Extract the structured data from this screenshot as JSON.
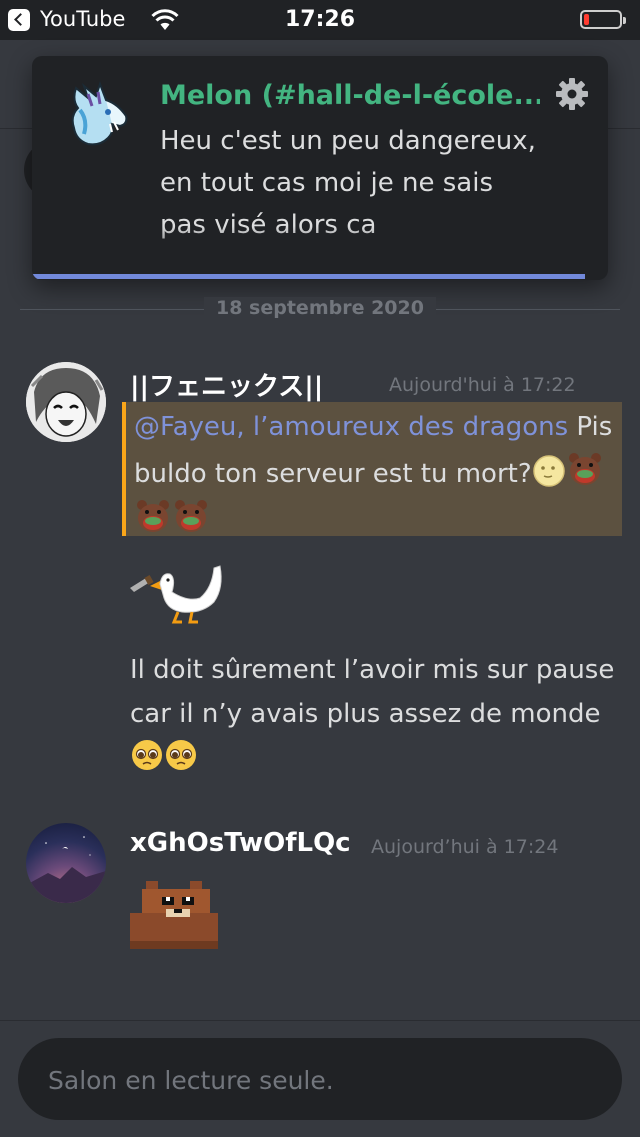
{
  "status_bar": {
    "back_app": "YouTube",
    "time": "17:26",
    "battery_level": 0.15,
    "battery_color": "#ff3b30"
  },
  "notification": {
    "title": "Melon (#hall-de-l-école...",
    "body": "Heu c'est un peu dangereux, en tout cas moi je ne sais pas visé alors ca",
    "icon_settings": "gear-icon",
    "progress": 0.96,
    "accent": "#7289da",
    "title_color": "#43b581"
  },
  "date_divider": "18 septembre 2020",
  "messages": [
    {
      "author": "||フェニックス||",
      "timestamp": "Aujourd'hui à 17:22",
      "mention": "@Fayeu, l’amoureux des dragons",
      "mention_text": "Pis buldo ton serveur est tu mort?",
      "second_text": "Il doit sûrement l’avoir mis sur pause car il n’y avais plus assez de monde"
    },
    {
      "author": "xGhOsTwOfLQc",
      "timestamp": "Aujourd’hui à 17:24"
    }
  ],
  "composer": {
    "placeholder": "Salon en lecture seule."
  },
  "colors": {
    "background": "#36393f",
    "mention_highlight": "#5c5140",
    "mention_border": "#faa61a",
    "link": "#7f92d9"
  }
}
